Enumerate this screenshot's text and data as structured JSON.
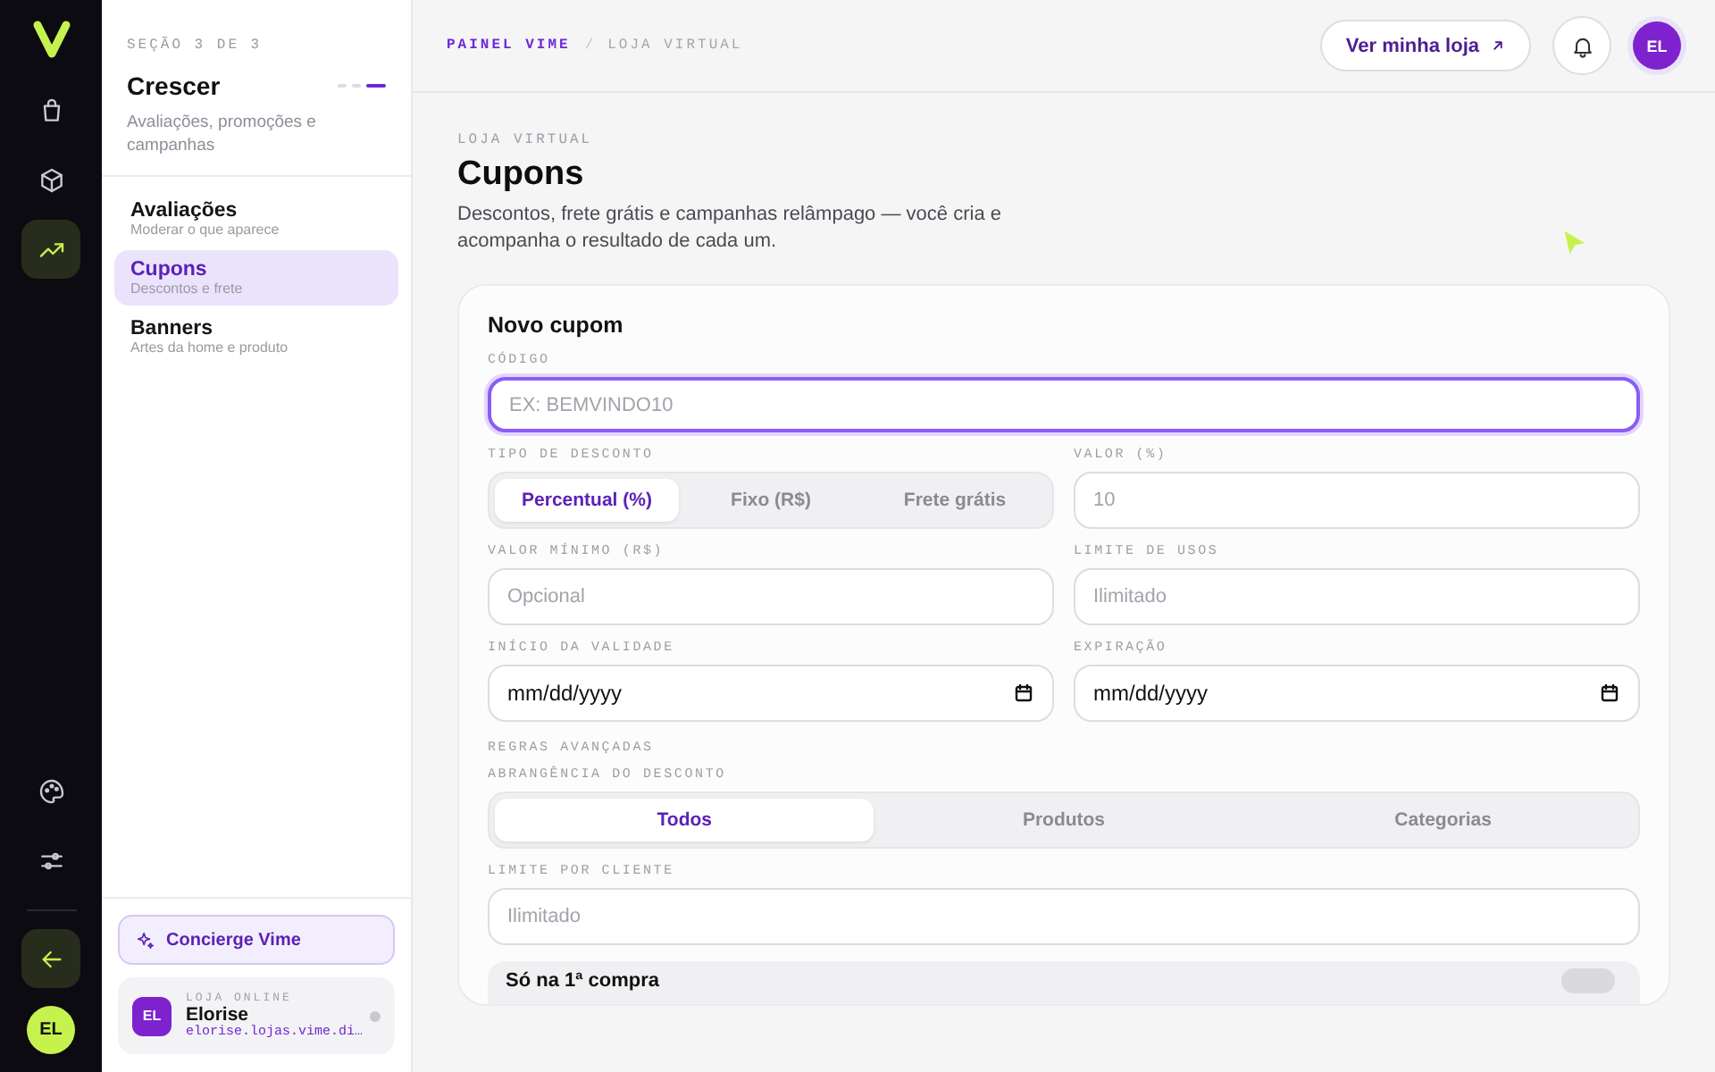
{
  "rail": {
    "items": [
      {
        "selected": false
      },
      {
        "selected": false
      },
      {
        "selected": true
      },
      {
        "selected": false
      },
      {
        "selected": false
      }
    ],
    "avatar": "EL"
  },
  "sidebar": {
    "section": "SEÇÃO 3 DE 3",
    "title": "Crescer",
    "steps": [
      {
        "active": false
      },
      {
        "active": false
      },
      {
        "active": true
      }
    ],
    "description": "Avaliações, promoções e campanhas",
    "nav": [
      {
        "title": "Avaliações",
        "subtitle": "Moderar o que aparece",
        "selected": false
      },
      {
        "title": "Cupons",
        "subtitle": "Descontos e frete",
        "selected": true
      },
      {
        "title": "Banners",
        "subtitle": "Artes da home e produto",
        "selected": false
      }
    ],
    "concierge": "Concierge Vime",
    "store": {
      "avatar": "EL",
      "label": "LOJA ONLINE",
      "name": "Elorise",
      "url": "elorise.lojas.vime.di…",
      "online": false
    }
  },
  "header": {
    "breadcrumb": [
      "PAINEL VIME",
      "LOJA VIRTUAL"
    ],
    "separator": "/",
    "store_button": "Ver minha loja",
    "avatar": "EL"
  },
  "page": {
    "eyebrow": "LOJA VIRTUAL",
    "title": "Cupons",
    "description": "Descontos, frete grátis e campanhas relâmpago — você cria e acompanha o resultado de cada um."
  },
  "form": {
    "title": "Novo cupom",
    "rows": [
      {
        "fields": [
          {
            "kind": "text",
            "label": "CÓDIGO",
            "placeholder": "EX: BEMVINDO10",
            "focused": true
          }
        ]
      },
      {
        "fields": [
          {
            "kind": "segmented",
            "label": "TIPO DE DESCONTO",
            "options": [
              {
                "label": "Percentual (%)",
                "selected": true
              },
              {
                "label": "Fixo (R$)",
                "selected": false
              },
              {
                "label": "Frete grátis",
                "selected": false
              }
            ]
          },
          {
            "kind": "text",
            "label": "VALOR (%)",
            "placeholder": "10",
            "focused": false
          }
        ]
      },
      {
        "fields": [
          {
            "kind": "text",
            "label": "VALOR MÍNIMO (R$)",
            "placeholder": "Opcional",
            "focused": false
          },
          {
            "kind": "text",
            "label": "LIMITE DE USOS",
            "placeholder": "Ilimitado",
            "focused": false
          }
        ]
      },
      {
        "fields": [
          {
            "kind": "date",
            "label": "INÍCIO DA VALIDADE",
            "value": "mm/dd/yyyy"
          },
          {
            "kind": "date",
            "label": "EXPIRAÇÃO",
            "value": "mm/dd/yyyy"
          }
        ]
      },
      {
        "fields": [
          {
            "kind": "heading",
            "label": "REGRAS AVANÇADAS"
          }
        ]
      },
      {
        "fields": [
          {
            "kind": "segmented",
            "label": "ABRANGÊNCIA DO DESCONTO",
            "options": [
              {
                "label": "Todos",
                "selected": true
              },
              {
                "label": "Produtos",
                "selected": false
              },
              {
                "label": "Categorias",
                "selected": false
              }
            ]
          }
        ]
      },
      {
        "fields": [
          {
            "kind": "text",
            "label": "LIMITE POR CLIENTE",
            "placeholder": "Ilimitado",
            "focused": false
          }
        ]
      }
    ],
    "toggle": {
      "label": "Só na 1ª compra",
      "on": false
    }
  }
}
